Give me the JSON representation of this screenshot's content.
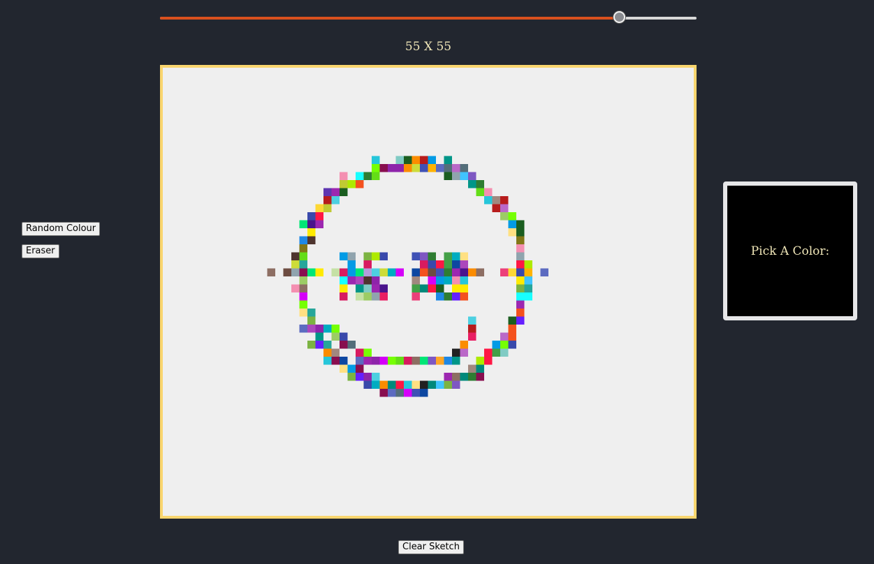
{
  "grid_size_label": "55 X 55",
  "slider": {
    "min": 1,
    "max": 64,
    "value": 55,
    "accent": "#d9501e"
  },
  "buttons": {
    "random_colour": "Random Colour",
    "eraser": "Eraser",
    "clear_sketch": "Clear Sketch"
  },
  "color_picker": {
    "label": "Pick A Color:",
    "value": "#000000"
  },
  "canvas": {
    "background": "#efefef",
    "frame_color": "#f9d56e",
    "grid_cells": 55,
    "drawing": "multicolour smiley face drawn with random-colour cells"
  }
}
